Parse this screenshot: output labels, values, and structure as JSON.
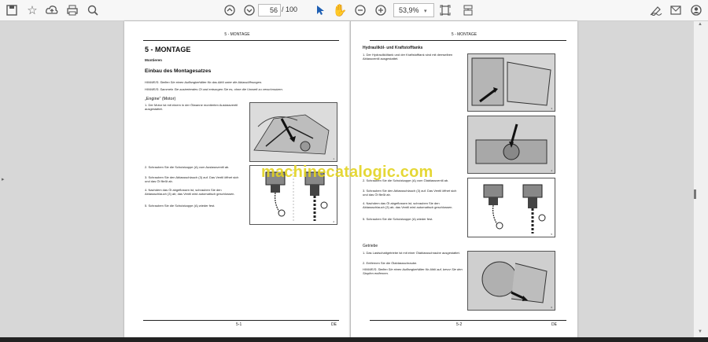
{
  "toolbar": {
    "current_page": "56",
    "page_separator": "/",
    "total_pages": "100",
    "zoom": "53,9%"
  },
  "page_left": {
    "header": "5 - MONTAGE",
    "title": "5 - MONTAGE",
    "subtitle": "Montieren",
    "section": "Einbau des Montagesatzes",
    "notes": [
      "HINWEIS: Stellen Sie einen Auffangbehälter für das Altöl unter die Ablassöffnungen.",
      "HINWEIS: Sammeln Sie austretendes Öl und entsorgen Sie es, ohne die Umwelt zu verschmutzen."
    ],
    "engine_heading": "„Engine“ (Motor)",
    "step1": "1.  Der Motor ist mit einem in der Ölwanne montierten Auslassventil ausgestattet.",
    "step2": "2.  Schrauben Sie die Schutzkappe (A) vom Auslassventil ab.",
    "step3": "3.  Schrauben Sie den Ablassschlauch (3) auf. Das Ventil öffnet sich und das Öl fließt ab.",
    "step4": "4.  Nachdem das Öl abgeflossen ist, schrauben Sie den Ablassschlauch (3) ab; das Ventil wird automatisch geschlossen.",
    "step5": "5.  Schrauben Sie die Schutzkappe (A) wieder fest.",
    "footer_page": "5-1",
    "footer_lang": "DE"
  },
  "page_right": {
    "header": "5 - MONTAGE",
    "section": "Hydrauliköl- und Kraftstofftanks",
    "step1": "1.  Der Hydrauliköltank und der Kraftstofftank sind mit demselben Ablassventil ausgestattet.",
    "step2": "2.  Schrauben Sie die Schutzkappe (A) vom Ölablassventil ab.",
    "step3": "3.  Schrauben Sie den Ablassschlauch (3) auf. Das Ventil öffnet sich und das Öl fließt ab.",
    "step4": "4.  Nachdem das Öl abgeflossen ist, schrauben Sie den Ablassschlauch (3) ab; das Ventil wird automatisch geschlossen.",
    "step5": "5.  Schrauben Sie die Schutzkappe (A) wieder fest.",
    "gearbox_heading": "Getriebe",
    "gear1": "1.  Das Lastschaltgetriebe ist mit einer Ölablassschraube ausgestattet.",
    "gear2": "2.  Entfernen Sie die Ölablassschraube.",
    "gear_note": "HINWEIS: Stellen Sie einen Auffangbehälter für Altöl auf, bevor Sie den Stopfen entfernen.",
    "footer_page": "5-2",
    "footer_lang": "DE"
  },
  "watermark": "machinecatalogic.com",
  "icons": [
    "save-icon",
    "bookmark-star-icon",
    "upload-icon",
    "print-icon",
    "zoom-search-icon",
    "page-up-icon",
    "page-down-icon",
    "select-cursor-icon",
    "hand-tool-icon",
    "zoom-out-icon",
    "zoom-in-icon",
    "fit-page-icon",
    "scroll-mode-icon",
    "sign-icon",
    "mail-icon",
    "account-icon"
  ]
}
